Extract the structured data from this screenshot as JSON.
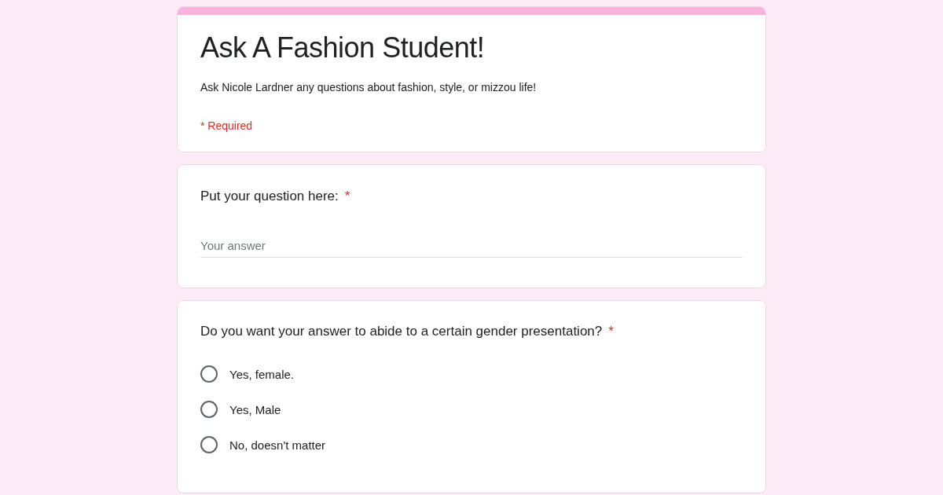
{
  "form": {
    "title": "Ask A Fashion Student!",
    "description": "Ask Nicole Lardner any questions about fashion, style, or mizzou life!",
    "required_note": "* Required"
  },
  "questions": [
    {
      "kind": "text",
      "label": "Put your question here:",
      "required_mark": "*",
      "placeholder": "Your answer"
    },
    {
      "kind": "radio",
      "label": "Do you want your answer to abide to a certain gender presentation?",
      "required_mark": "*",
      "options": [
        {
          "label": "Yes, female.",
          "selected": false
        },
        {
          "label": "Yes, Male",
          "selected": false
        },
        {
          "label": "No, doesn't matter",
          "selected": false
        }
      ]
    }
  ]
}
